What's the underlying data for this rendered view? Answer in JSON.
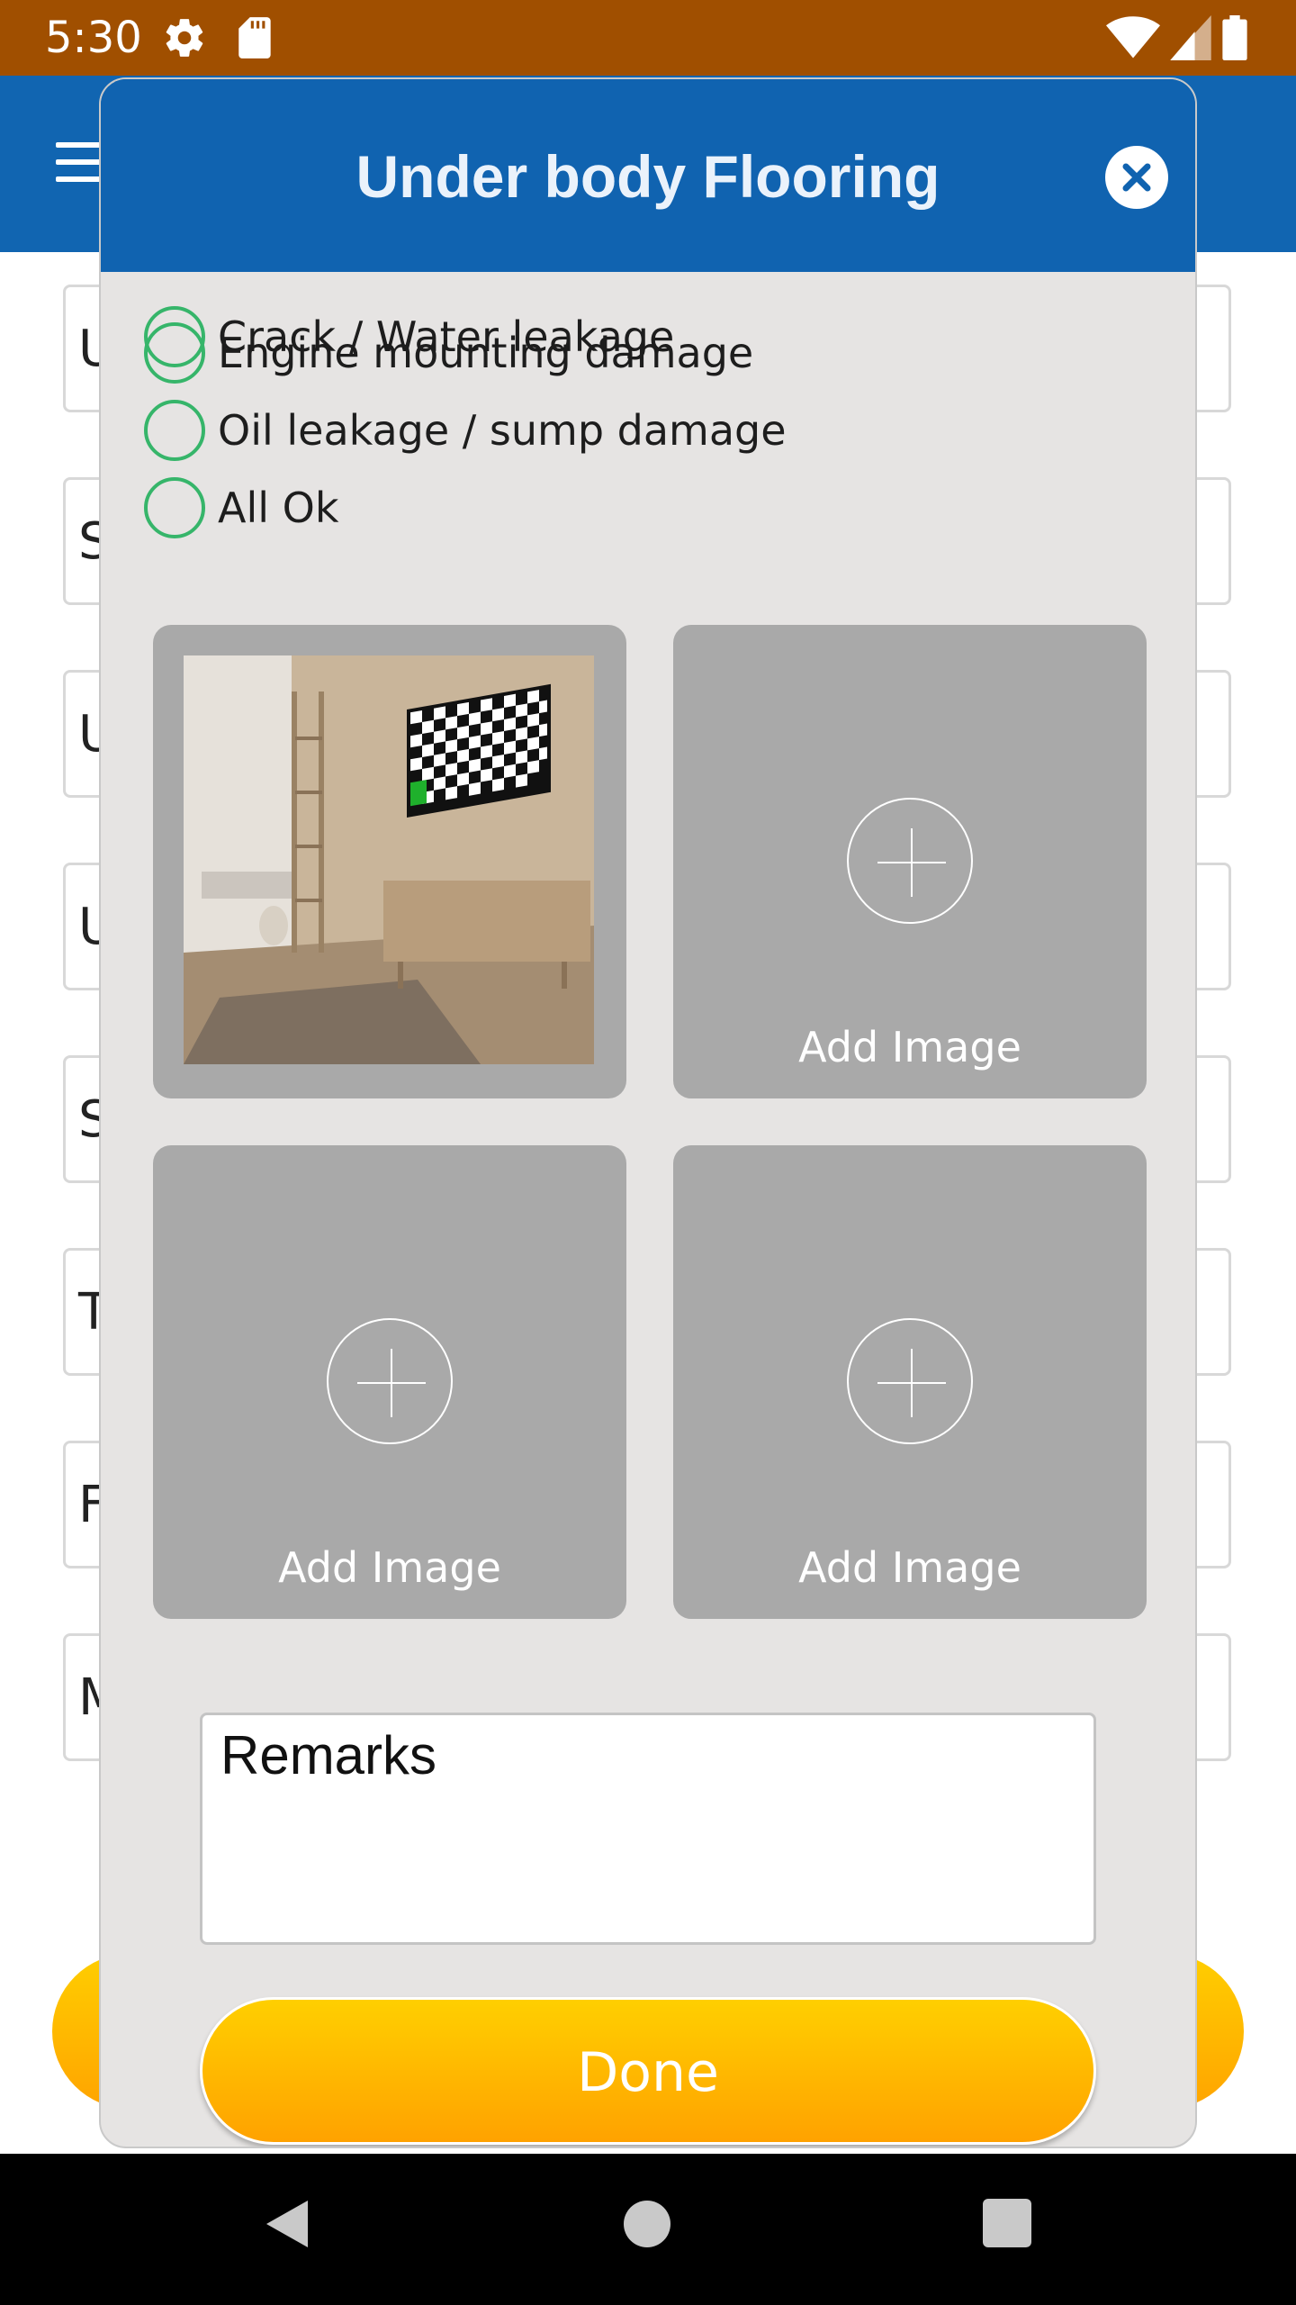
{
  "status_bar": {
    "time": "5:30",
    "icons": [
      "gear-icon",
      "sd-card-icon",
      "wifi-icon",
      "signal-icon",
      "battery-icon"
    ]
  },
  "background_fields": [
    {
      "initial": "U"
    },
    {
      "initial": "S"
    },
    {
      "initial": "U"
    },
    {
      "initial": "U"
    },
    {
      "initial": "S"
    },
    {
      "initial": "T"
    },
    {
      "initial": "F"
    },
    {
      "initial": "M"
    }
  ],
  "modal": {
    "title": "Under body Flooring",
    "options": [
      {
        "label": "Crack / Water leakage",
        "selected": false
      },
      {
        "label": "Engine mounting damage",
        "selected": false
      },
      {
        "label": "Oil leakage / sump damage",
        "selected": false
      },
      {
        "label": "All Ok",
        "selected": false
      }
    ],
    "images": [
      {
        "has_photo": true,
        "label": ""
      },
      {
        "has_photo": false,
        "label": "Add Image"
      },
      {
        "has_photo": false,
        "label": "Add Image"
      },
      {
        "has_photo": false,
        "label": "Add Image"
      }
    ],
    "remarks_placeholder": "Remarks",
    "done_label": "Done"
  },
  "colors": {
    "status_bar": "#a04f00",
    "primary": "#1165b1",
    "radio": "#36b56a",
    "accent": "#ffb800",
    "modal_bg": "#e6e4e3",
    "tile": "#a9a9a9"
  }
}
